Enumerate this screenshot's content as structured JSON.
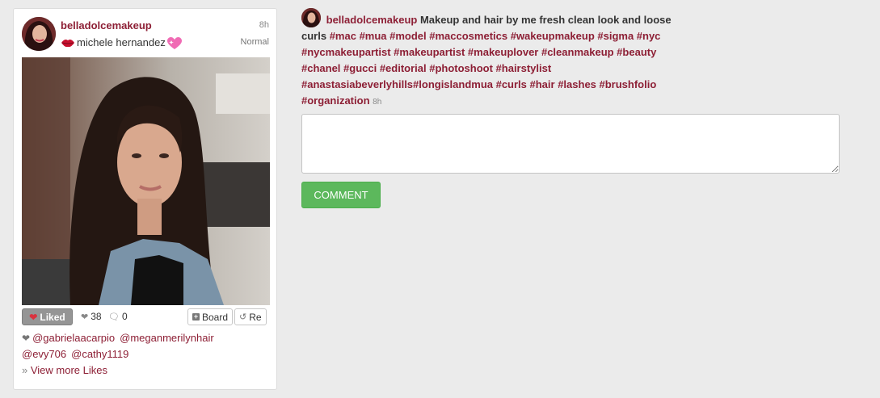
{
  "card": {
    "owner": "belladolcemakeup",
    "time": "8h",
    "poster_name": "michele hernandez",
    "filter": "Normal",
    "liked_label": "Liked",
    "likes_count": "38",
    "comments_count": "0",
    "board_label": "Board",
    "repost_label": "Re",
    "likers": [
      "@gabrielaacarpio",
      "@meganmerilynhair",
      "@evy706",
      "@cathy1119"
    ],
    "view_more_label": "View more Likes"
  },
  "caption": {
    "user": "belladolcemakeup",
    "text": "Makeup and hair by me fresh clean look and loose curls",
    "hashtags": "#mac #mua #model #maccosmetics #wakeupmakeup #sigma #nyc #nycmakeupartist #makeupartist #makeuplover #cleanmakeup #beauty #chanel #gucci #editorial #photoshoot #hairstylist #anastasiabeverlyhills#longislandmua #curls #hair #lashes #brushfolio #organization",
    "time": "8h"
  },
  "comment": {
    "placeholder": "",
    "button_label": "COMMENT"
  },
  "colors": {
    "accent": "#8d1f35",
    "button_green": "#5cb85c",
    "liked_grey": "#959595"
  }
}
